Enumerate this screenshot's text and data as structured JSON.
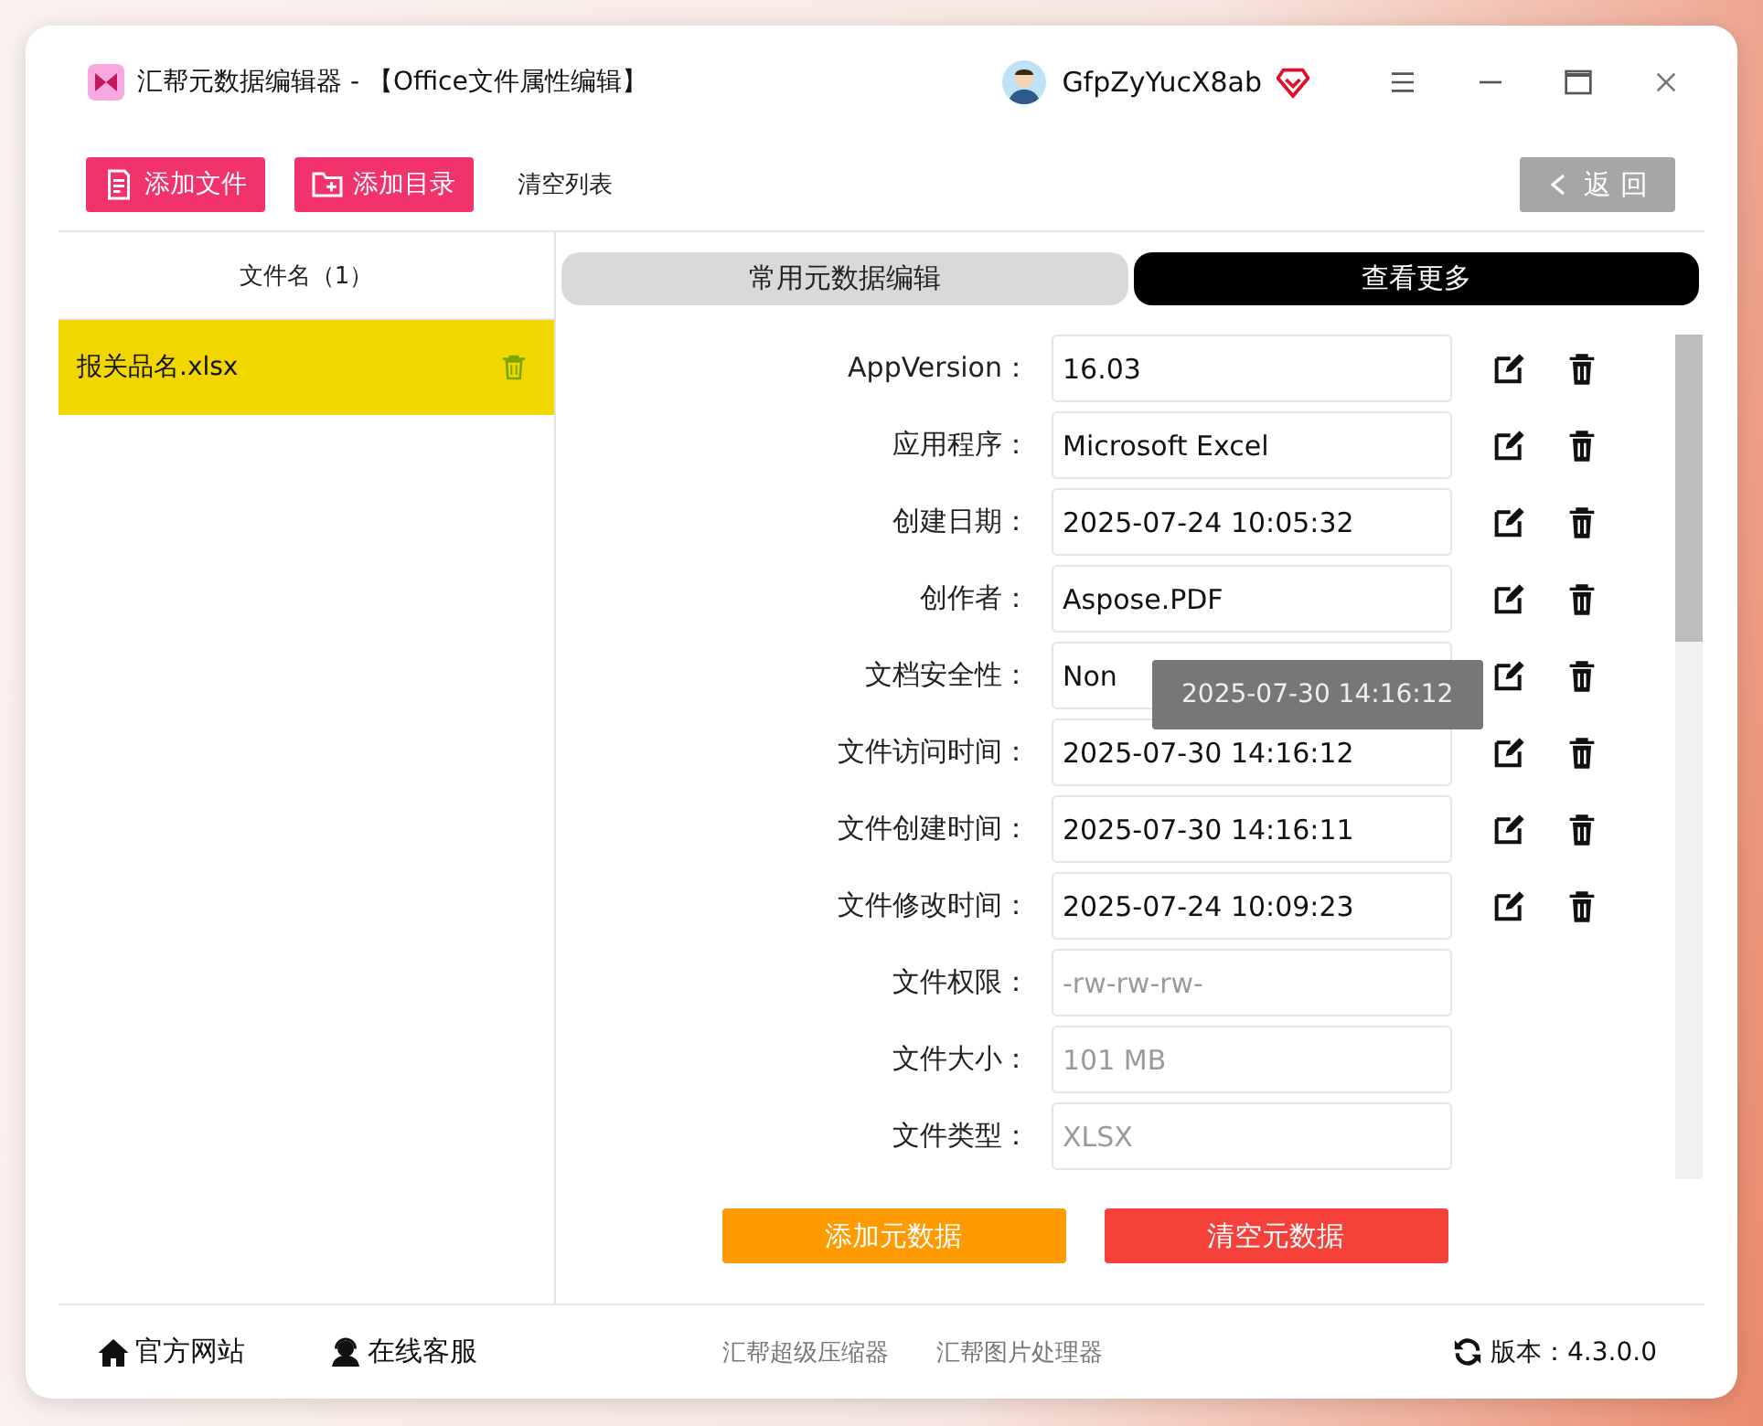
{
  "window": {
    "title": "汇帮元数据编辑器 - 【Office文件属性编辑】",
    "user": "GfpZyYucX8ab"
  },
  "toolbar": {
    "buttons": [
      {
        "label": "添加文件",
        "kind": "file"
      },
      {
        "label": "添加目录",
        "kind": "folder"
      },
      {
        "label": "清空列表",
        "kind": "plain"
      }
    ],
    "back_button": "返 回"
  },
  "file_list": {
    "header": "文件名（1）",
    "items": [
      {
        "name": "报关品名.xlsx",
        "selected": true
      }
    ]
  },
  "tabs": [
    {
      "label": "常用元数据编辑",
      "selected": false
    },
    {
      "label": "查看更多",
      "selected": true
    }
  ],
  "fields": [
    {
      "label": "AppVersion：",
      "value": "16.03",
      "kind": "editable"
    },
    {
      "label": "应用程序：",
      "value": "Microsoft Excel",
      "kind": "editable"
    },
    {
      "label": "创建日期：",
      "value": "2025-07-24 10:05:32",
      "kind": "editable"
    },
    {
      "label": "创作者：",
      "value": "Aspose.PDF",
      "kind": "editable"
    },
    {
      "label": "文档安全性：",
      "value": "Non",
      "kind": "editable"
    },
    {
      "label": "文件访问时间：",
      "value": "2025-07-30 14:16:12",
      "kind": "editable"
    },
    {
      "label": "文件创建时间：",
      "value": "2025-07-30 14:16:11",
      "kind": "editable"
    },
    {
      "label": "文件修改时间：",
      "value": "2025-07-24 10:09:23",
      "kind": "editable"
    },
    {
      "label": "文件权限：",
      "value": "-rw-rw-rw-",
      "kind": "readonly"
    },
    {
      "label": "文件大小：",
      "value": "101 MB",
      "kind": "readonly"
    },
    {
      "label": "文件类型：",
      "value": "XLSX",
      "kind": "readonly"
    }
  ],
  "tooltip": "2025-07-30 14:16:12",
  "actions": [
    {
      "label": "添加元数据",
      "kind": "add"
    },
    {
      "label": "清空元数据",
      "kind": "clear"
    }
  ],
  "footer": {
    "links": [
      {
        "label": "官方网站",
        "kind": "home"
      },
      {
        "label": "在线客服",
        "kind": "support"
      }
    ],
    "tools": [
      "汇帮超级压缩器",
      "汇帮图片处理器"
    ],
    "version": "版本：4.3.0.0"
  }
}
